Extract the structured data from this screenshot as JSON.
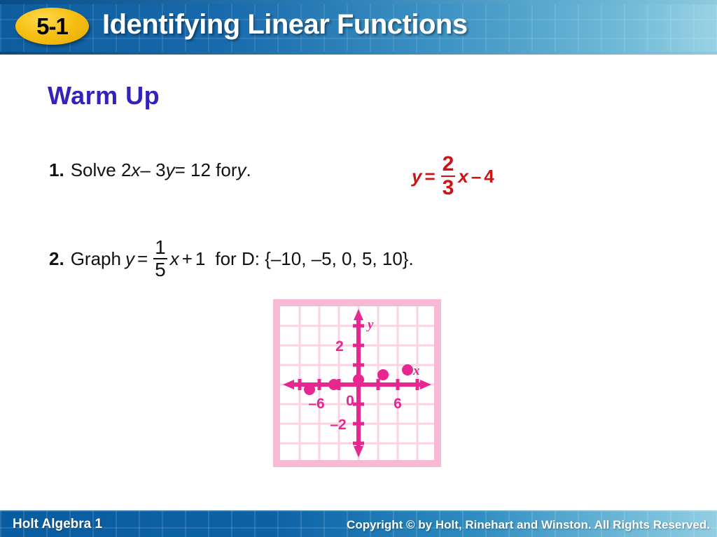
{
  "header": {
    "lesson_badge": "5-1",
    "title": "Identifying Linear Functions"
  },
  "main": {
    "section_title": "Warm Up",
    "problems": [
      {
        "number": "1.",
        "prompt_a": "Solve 2",
        "var1": "x",
        "op1": " – 3",
        "var2": "y",
        "prompt_b": " = 12 for ",
        "var3": "y",
        "prompt_c": ".",
        "answer": {
          "lhs_var": "y",
          "equals": "=",
          "frac_num": "2",
          "frac_den": "3",
          "frac_var": "x",
          "operator": "–",
          "constant": "4",
          "color": "#cc1414"
        }
      },
      {
        "number": "2.",
        "prompt_a": "Graph",
        "equation": {
          "lhs_var": "y",
          "equals": "=",
          "frac_num": "1",
          "frac_den": "5",
          "frac_var": "x",
          "operator": "+",
          "constant": "1"
        },
        "prompt_b": "for D: {–10, –5, 0, 5, 10}."
      }
    ]
  },
  "chart_data": {
    "type": "scatter",
    "title": "",
    "xlabel": "x",
    "ylabel": "y",
    "equation": "y = (1/5)x + 1",
    "domain": [
      -10,
      -5,
      0,
      5,
      10
    ],
    "points": [
      {
        "x": -10,
        "y": -1
      },
      {
        "x": -5,
        "y": 0
      },
      {
        "x": 0,
        "y": 1
      },
      {
        "x": 5,
        "y": 2
      },
      {
        "x": 10,
        "y": 3
      }
    ],
    "xlim": [
      -14,
      14
    ],
    "ylim": [
      -14,
      14
    ],
    "grid": true,
    "grid_step": 4,
    "tick_step": 2,
    "x_tick_labels": [
      "–6",
      "6"
    ],
    "y_tick_labels": [
      "2",
      "–2"
    ],
    "origin_label": "0",
    "legend": "none",
    "point_color": "#e8268f",
    "axis_color": "#e8268f",
    "grid_color": "#fbd3e4",
    "border_color": "#f7b9d4"
  },
  "footer": {
    "left_text": "Holt Algebra 1",
    "right_text": "Copyright © by Holt, Rinehart and Winston. All Rights Reserved."
  }
}
